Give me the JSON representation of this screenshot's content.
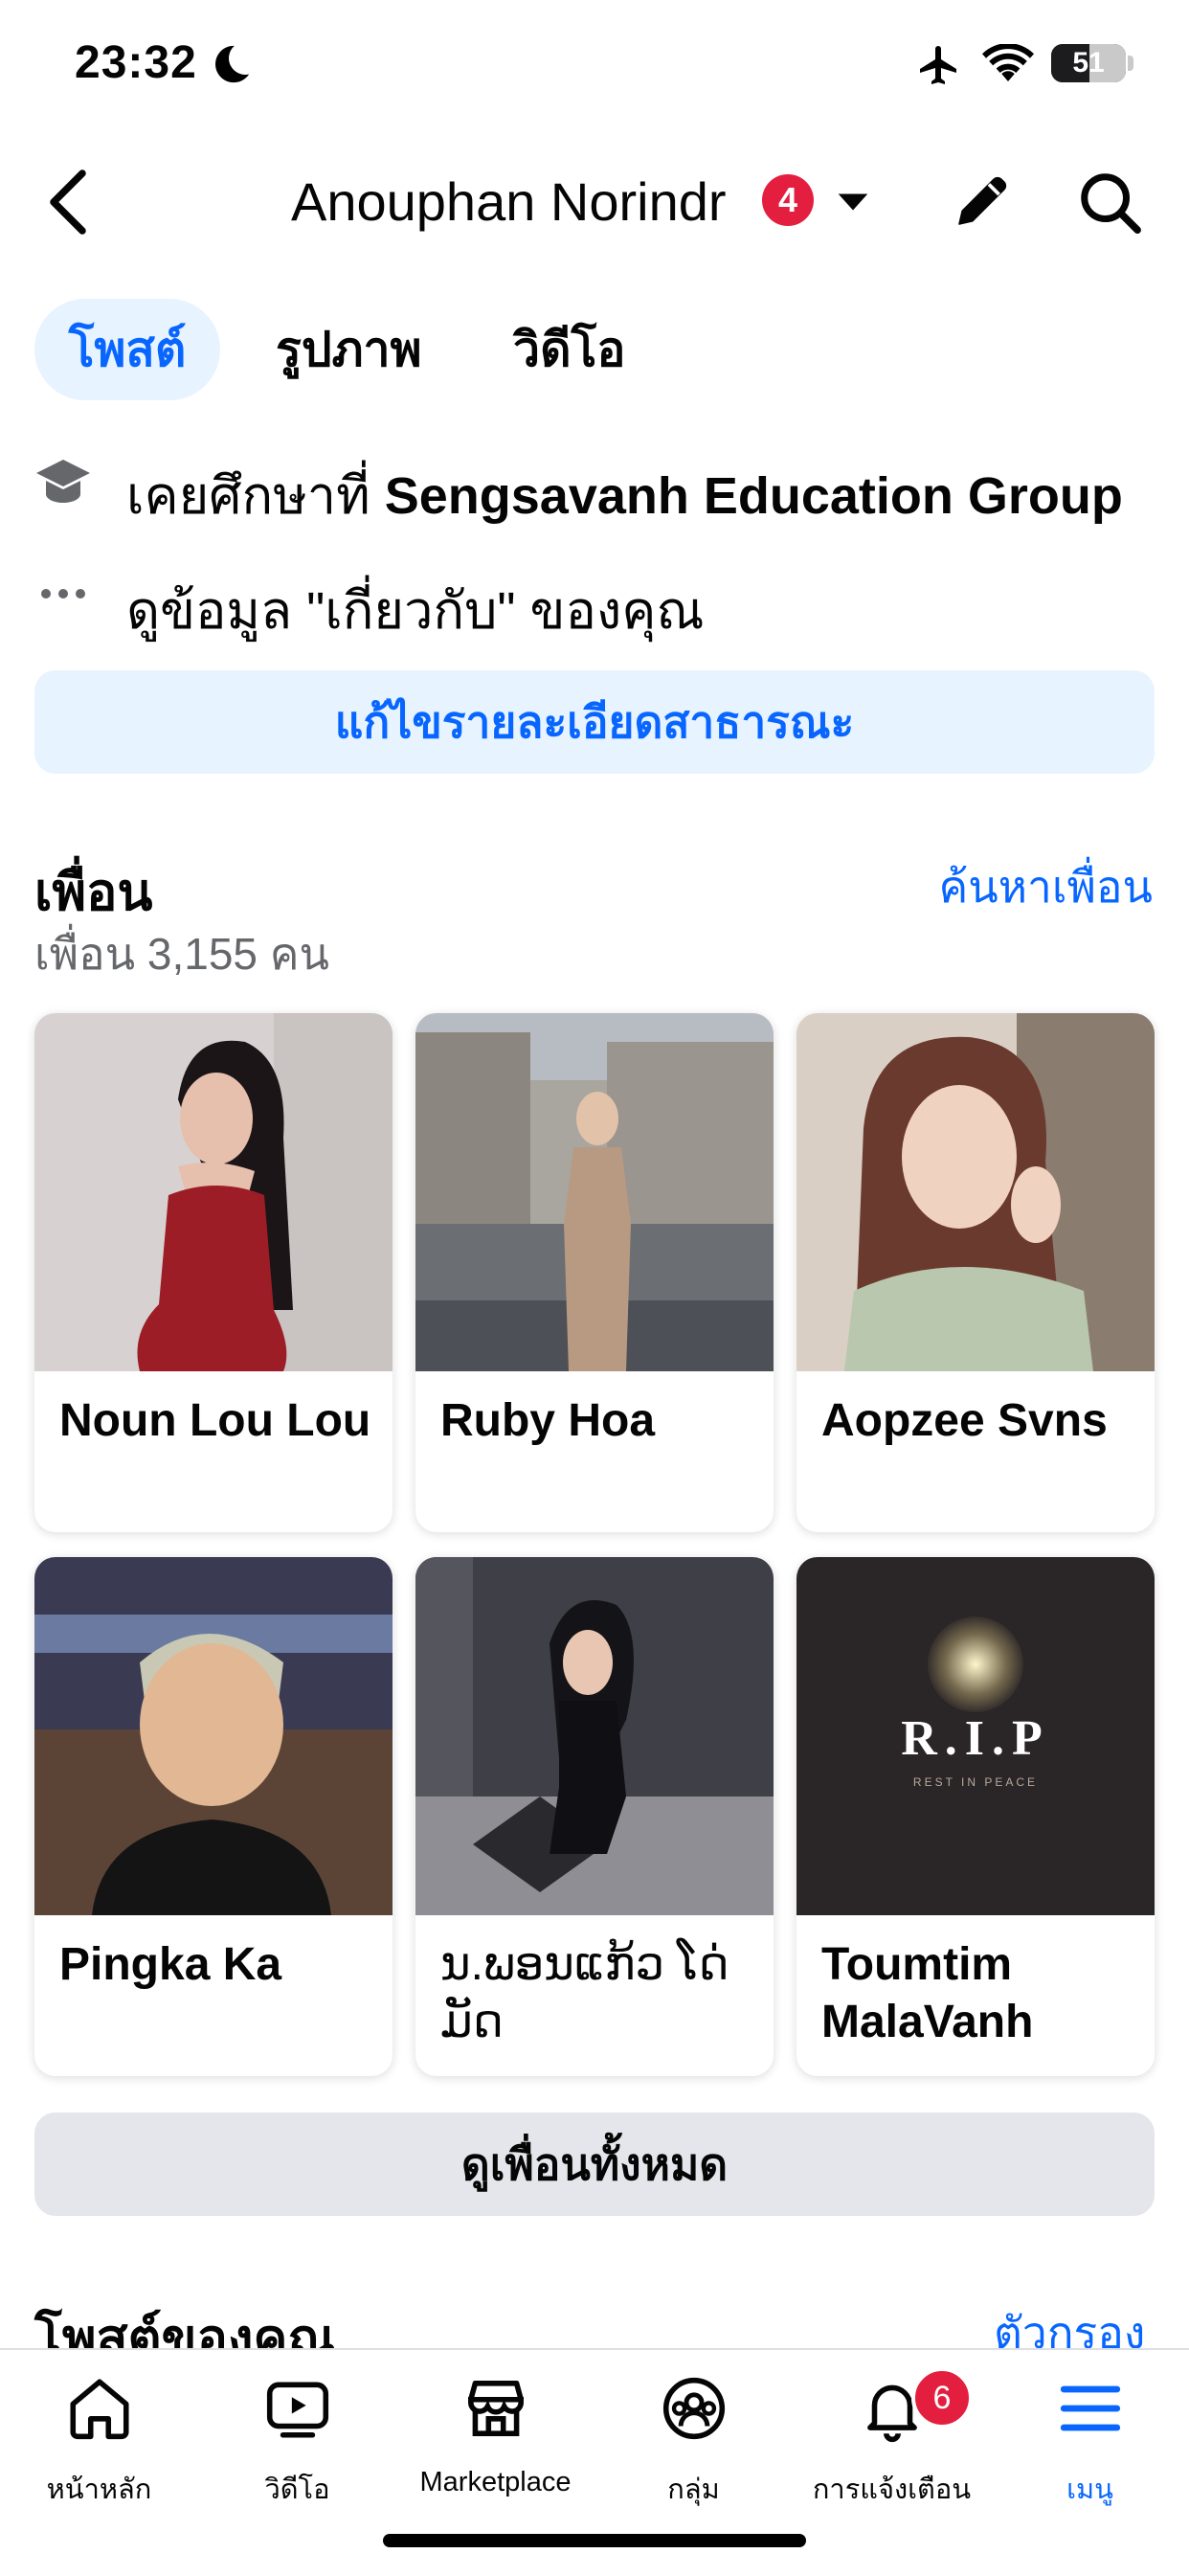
{
  "status_bar": {
    "time": "23:32",
    "battery": "51",
    "battery_level": 0.51
  },
  "header": {
    "title": "Anouphan Norindr",
    "badge": "4"
  },
  "tabs": [
    {
      "label": "โพสต์",
      "active": true
    },
    {
      "label": "รูปภาพ",
      "active": false
    },
    {
      "label": "วิดีโอ",
      "active": false
    }
  ],
  "intro": {
    "education_prefix": "เคยศึกษาที่",
    "education_place": "Sengsavanh Education Group",
    "about": "ดูข้อมูล \"เกี่ยวกับ\" ของคุณ",
    "edit_button": "แก้ไขรายละเอียดสาธารณะ"
  },
  "friends": {
    "title": "เพื่อน",
    "count": "เพื่อน 3,155 คน",
    "find_link": "ค้นหาเพื่อน",
    "items": [
      {
        "name": "Noun Lou Lou"
      },
      {
        "name": "Ruby Hoa"
      },
      {
        "name": "Aopzee Svns"
      },
      {
        "name": "Pingka Ka"
      },
      {
        "name": "ນ.ພອນແກ້ວ ໂດ່ມັດ"
      },
      {
        "name": "Toumtim MalaVanh"
      }
    ],
    "rip_main": "R.I.P",
    "rip_sub": "REST IN PEACE",
    "see_all": "ดูเพื่อนทั้งหมด"
  },
  "posts": {
    "title": "โพสต์ของคุณ",
    "filter": "ตัวกรอง"
  },
  "bottom_nav": [
    {
      "label": "หน้าหลัก",
      "icon": "home-icon"
    },
    {
      "label": "วิดีโอ",
      "icon": "video-icon"
    },
    {
      "label": "Marketplace",
      "icon": "marketplace-icon"
    },
    {
      "label": "กลุ่ม",
      "icon": "groups-icon"
    },
    {
      "label": "การแจ้งเตือน",
      "icon": "bell-icon",
      "badge": "6"
    },
    {
      "label": "เมนู",
      "icon": "menu-icon",
      "active": true
    }
  ],
  "colors": {
    "accent": "#0866ff",
    "badge": "#e41e3f",
    "secondary_text": "#65676b"
  }
}
